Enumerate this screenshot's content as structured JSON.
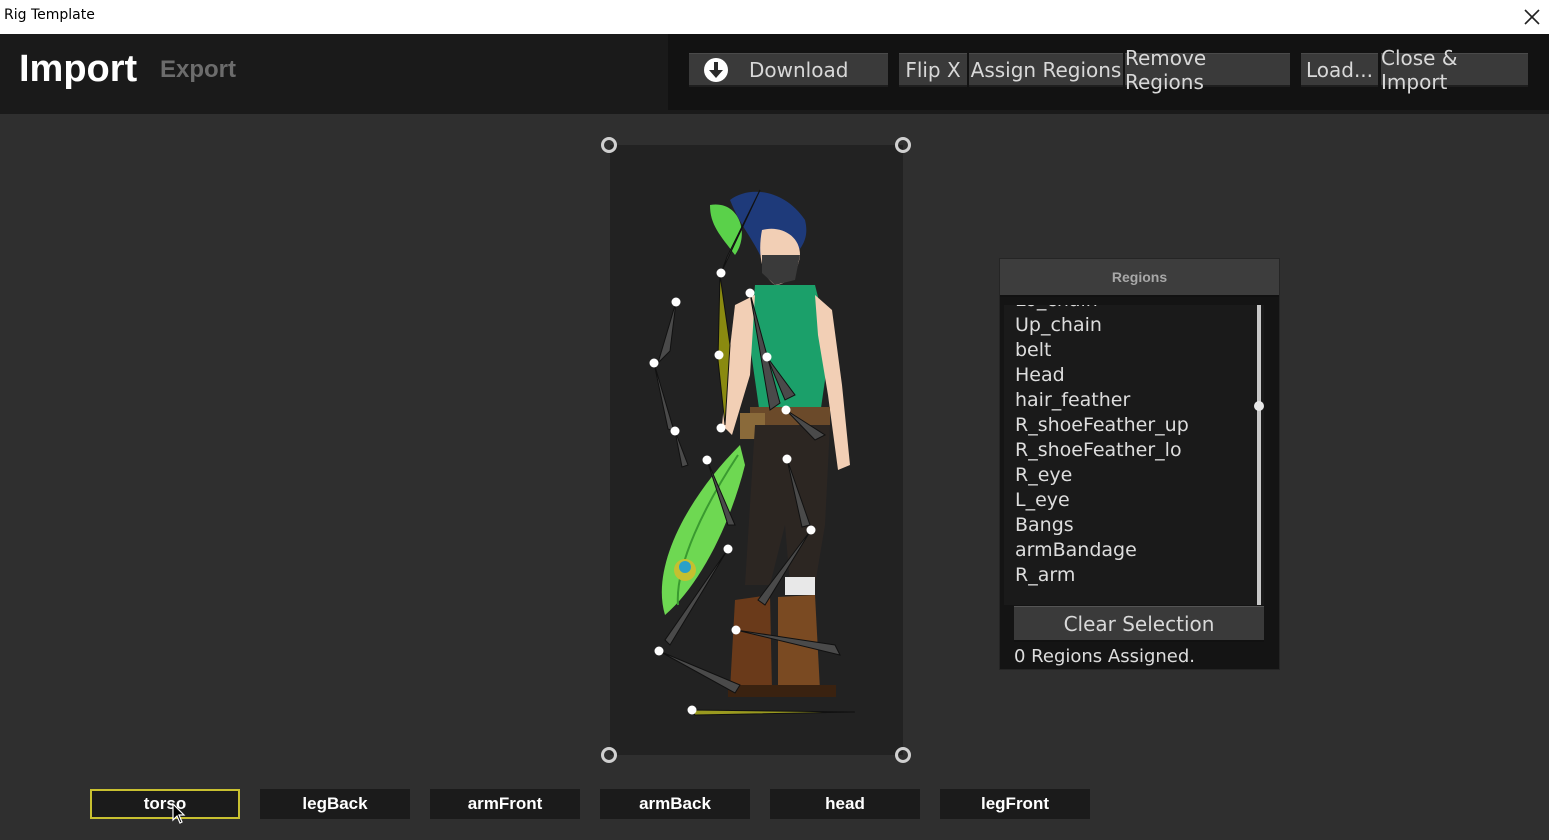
{
  "window": {
    "title": "Rig Template"
  },
  "header": {
    "tab_import": "Import",
    "tab_export": "Export"
  },
  "toolbar": {
    "download": "Download",
    "flip_x": "Flip X",
    "assign_regions": "Assign Regions",
    "remove_regions": "Remove Regions",
    "load": "Load...",
    "close_import": "Close & Import"
  },
  "regions": {
    "title": "Regions",
    "items": [
      "Lo_chain",
      "Up_chain",
      "belt",
      "Head",
      "hair_feather",
      "R_shoeFeather_up",
      "R_shoeFeather_lo",
      "R_eye",
      "L_eye",
      "Bangs",
      "armBandage",
      "R_arm"
    ],
    "scroll_position": 0.33,
    "clear_label": "Clear Selection",
    "status": "0 Regions Assigned."
  },
  "parts": {
    "items": [
      "torso",
      "legBack",
      "armFront",
      "armBack",
      "head",
      "legFront"
    ],
    "active": "torso"
  },
  "colors": {
    "active_outline": "#c8c030",
    "panel_bg": "#141414",
    "button_bg": "#3a3a3a"
  }
}
